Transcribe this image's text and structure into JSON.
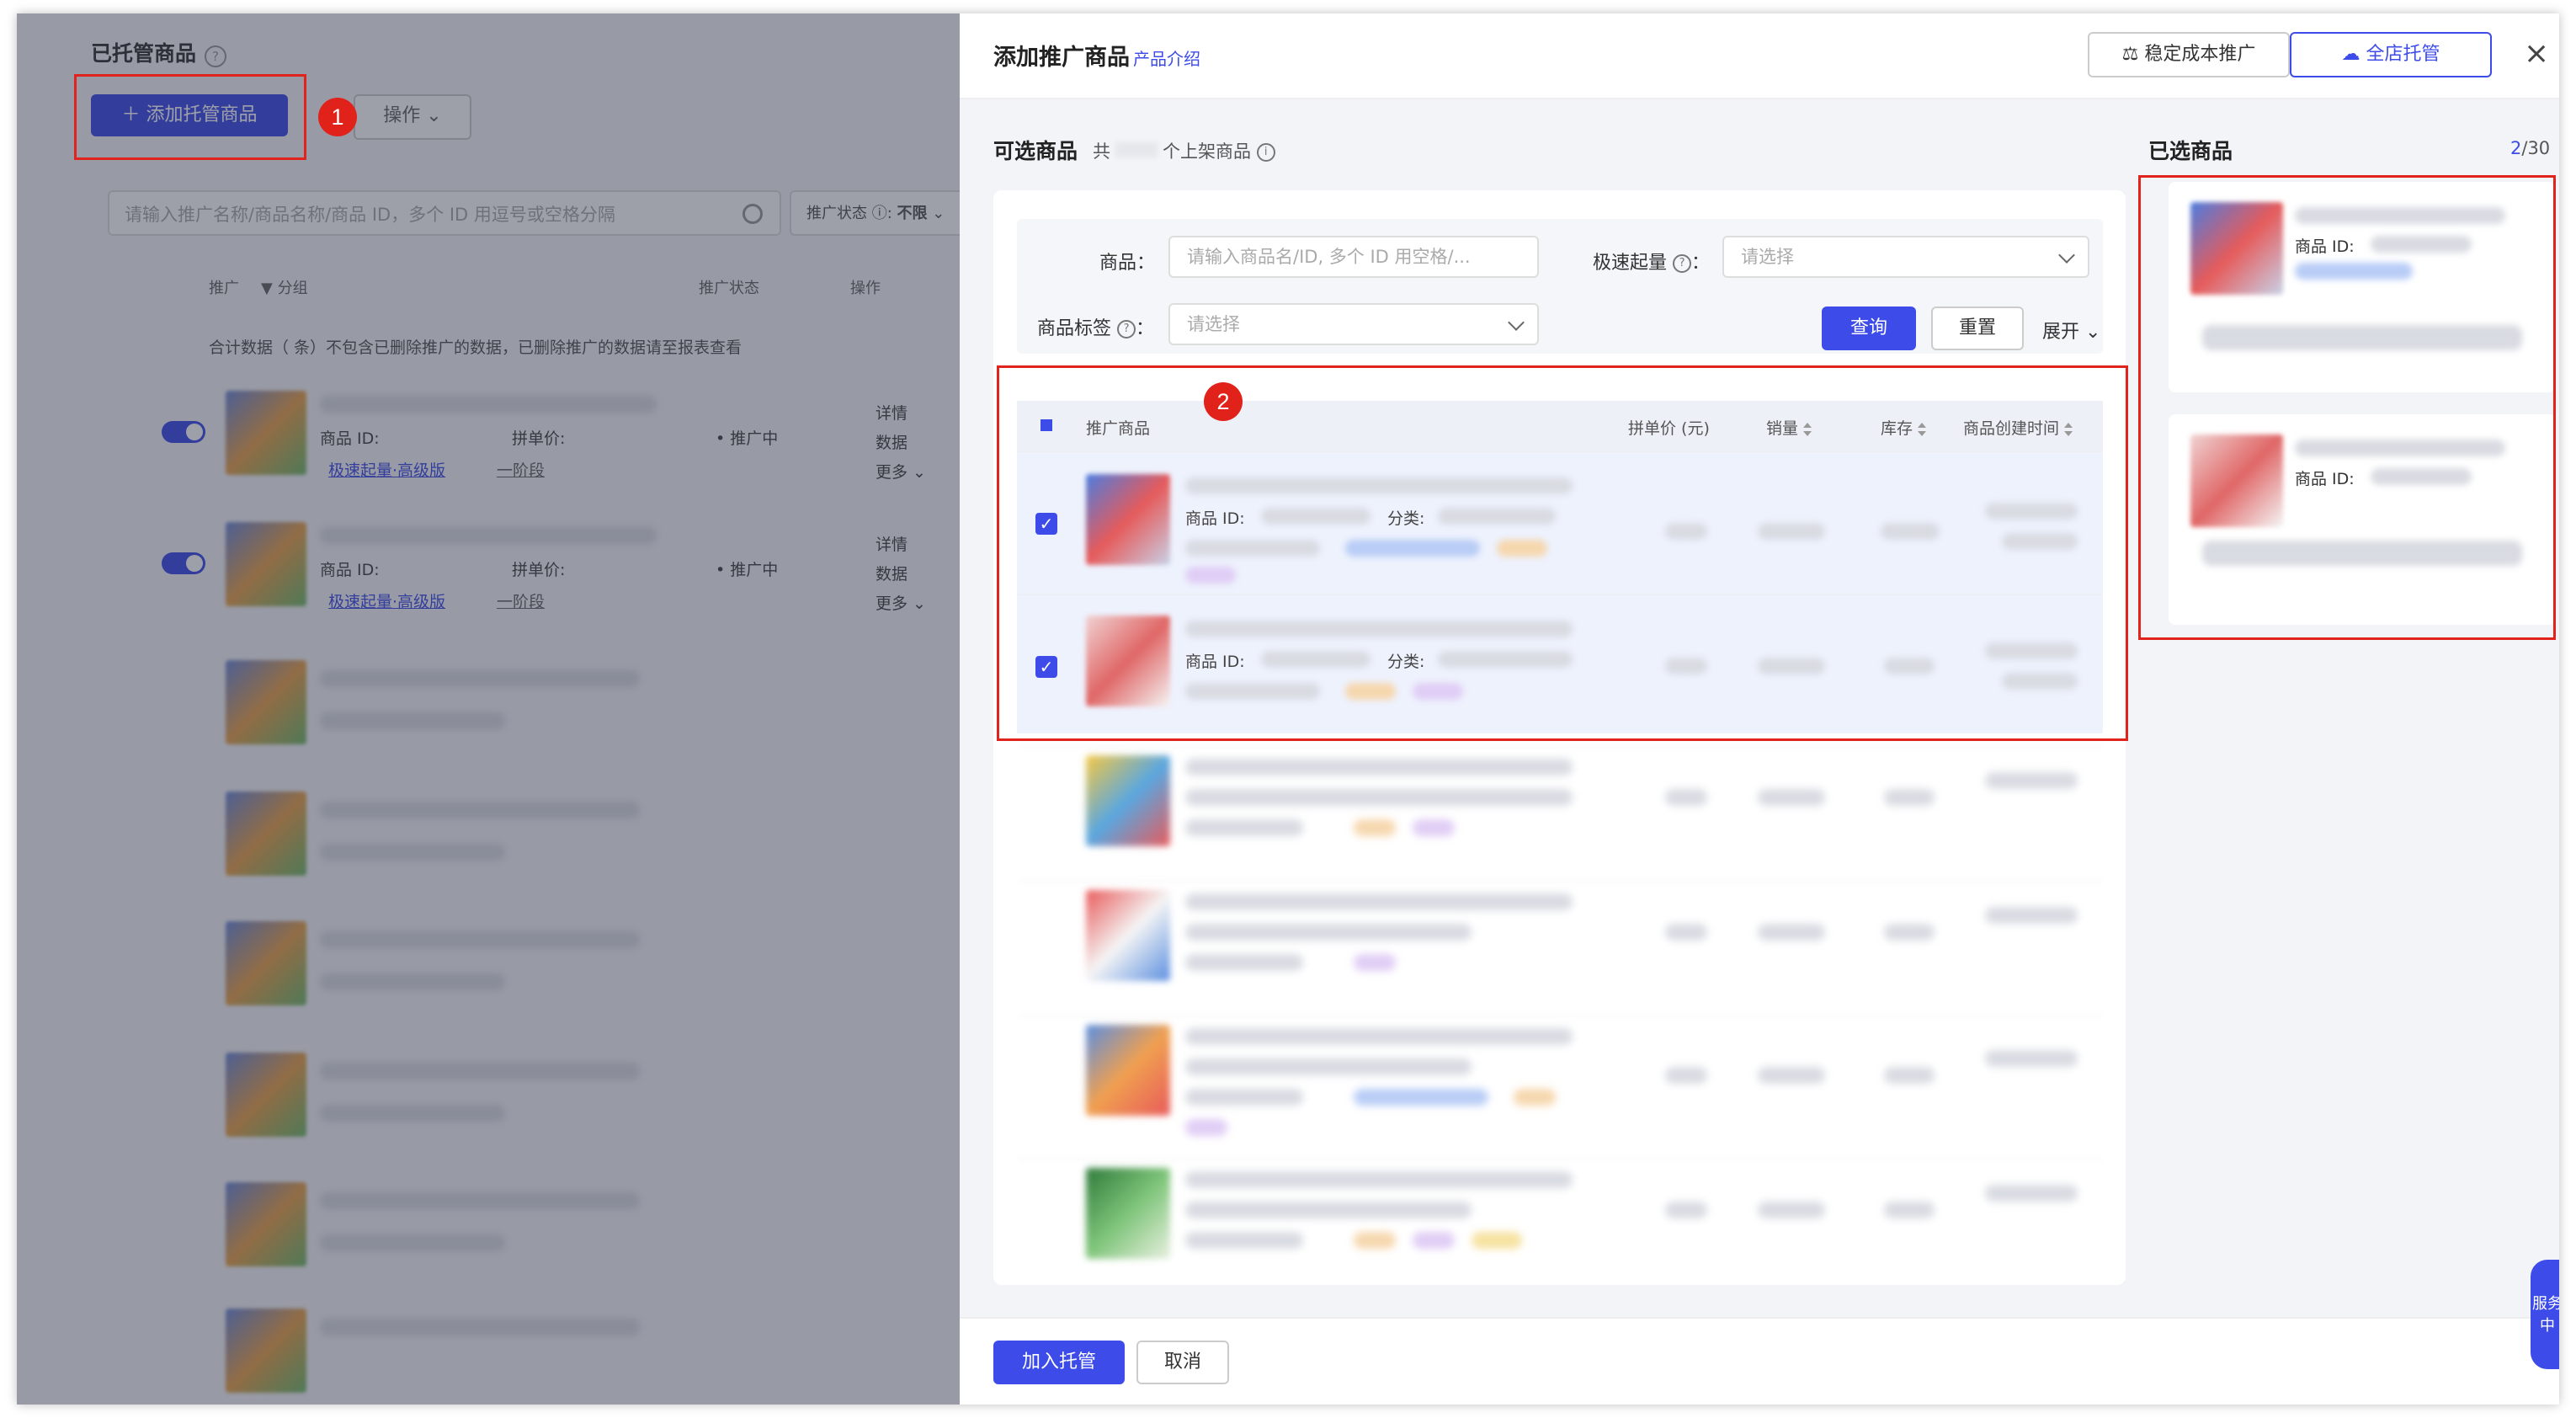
{
  "background": {
    "title": "已托管商品",
    "add_button": "添加托管商品",
    "op_button": "操作",
    "search_placeholder": "请输入推广名称/商品名称/商品 ID，多个 ID 用逗号或空格分隔",
    "filter_label": "推广状态",
    "filter_value": "不限",
    "col_promo": "推广",
    "col_group": "分组",
    "col_status": "推广状态",
    "col_action": "操作",
    "summary": "合计数据（     条）不包含已删除推广的数据，已删除推广的数据请至报表查看",
    "rows": [
      {
        "id_label": "商品 ID:",
        "price_label": "拼单价:",
        "tag": "极速起量·高级版",
        "stage": "一阶段",
        "status": "推广中",
        "a1": "详情",
        "a2": "数据",
        "a3": "更多"
      },
      {
        "id_label": "商品 ID:",
        "price_label": "拼单价:",
        "tag": "极速起量·高级版",
        "stage": "一阶段",
        "status": "推广中",
        "a1": "详情",
        "a2": "数据",
        "a3": "更多"
      }
    ]
  },
  "badges": {
    "one": "1",
    "two": "2"
  },
  "drawer": {
    "title": "添加推广商品",
    "intro_link": "产品介绍",
    "btn_stable": "稳定成本推广",
    "btn_full": "全店托管",
    "available_title": "可选商品",
    "available_sub_prefix": "共",
    "available_sub_suffix": "个上架商品",
    "filter": {
      "product_label": "商品：",
      "product_placeholder": "请输入商品名/ID, 多个 ID 用空格/...",
      "speed_label": "极速起量",
      "speed_placeholder": "请选择",
      "tag_label": "商品标签",
      "tag_placeholder": "请选择",
      "query": "查询",
      "reset": "重置",
      "expand": "展开"
    },
    "table": {
      "col_product": "推广商品",
      "col_price": "拼单价 (元)",
      "col_sales": "销量",
      "col_stock": "库存",
      "col_created": "商品创建时间",
      "id_label": "商品 ID:",
      "cat_label": "分类:"
    },
    "selected_title": "已选商品",
    "selected_count": "2",
    "selected_max": "/30",
    "selected_id_label": "商品 ID:",
    "join_button": "加入托管",
    "cancel_button": "取消",
    "service": "服务中"
  },
  "colors": {
    "accent": "#3d4ce8",
    "annotation": "#e0231c"
  }
}
